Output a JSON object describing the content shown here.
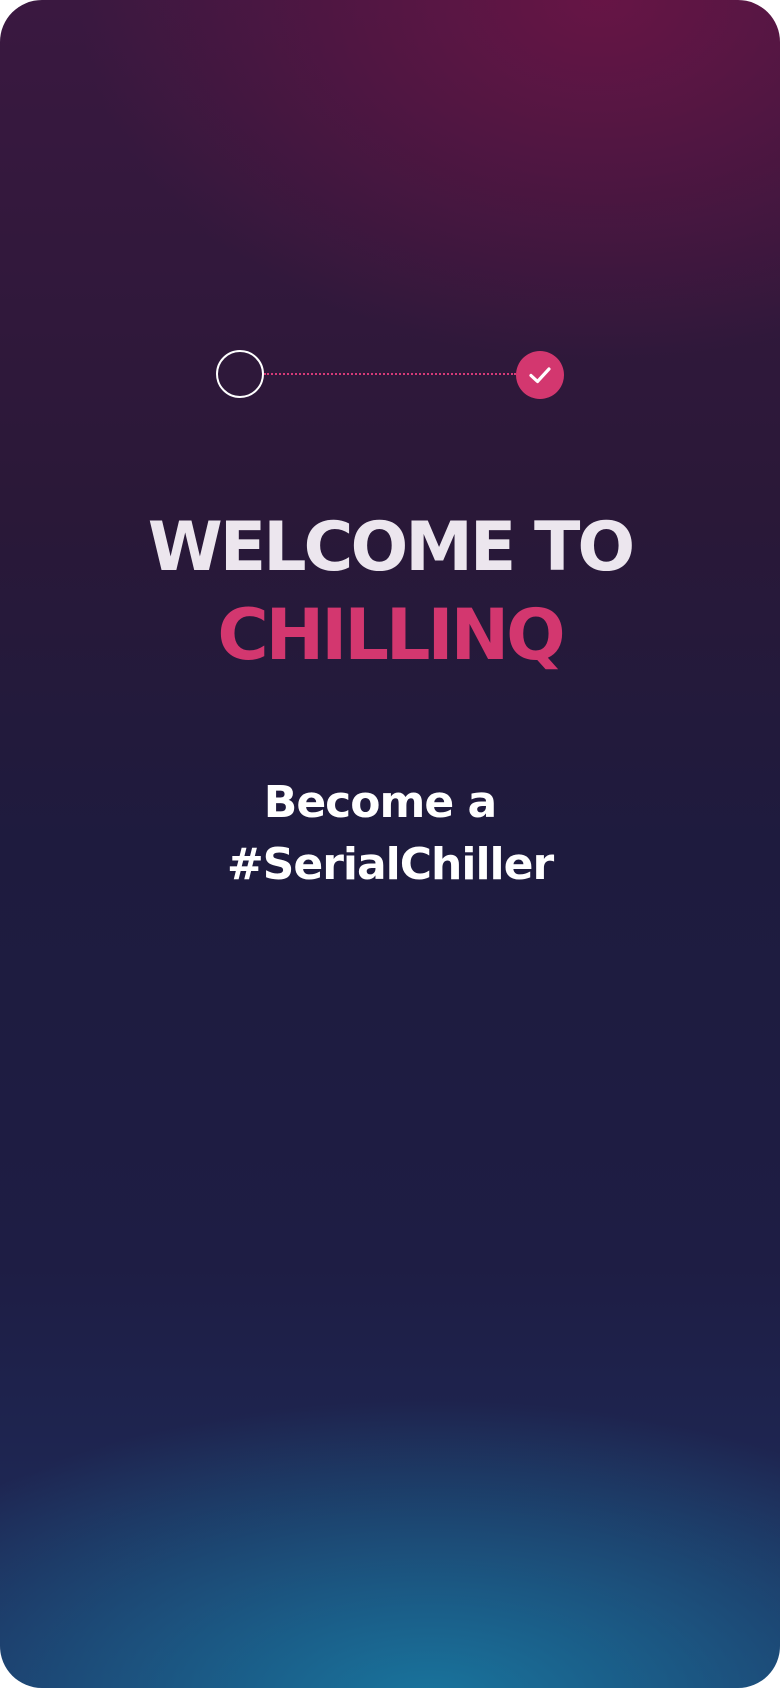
{
  "onboarding": {
    "stepper": {
      "steps": [
        {
          "state": "incomplete"
        },
        {
          "state": "complete",
          "icon": "check-icon"
        }
      ],
      "accent_color": "#d3376f"
    },
    "title": {
      "line1": "WELCOME TO",
      "line2": "CHILLINQ"
    },
    "subtitle": {
      "line1": "Become a",
      "line2": "#SerialChiller"
    }
  }
}
